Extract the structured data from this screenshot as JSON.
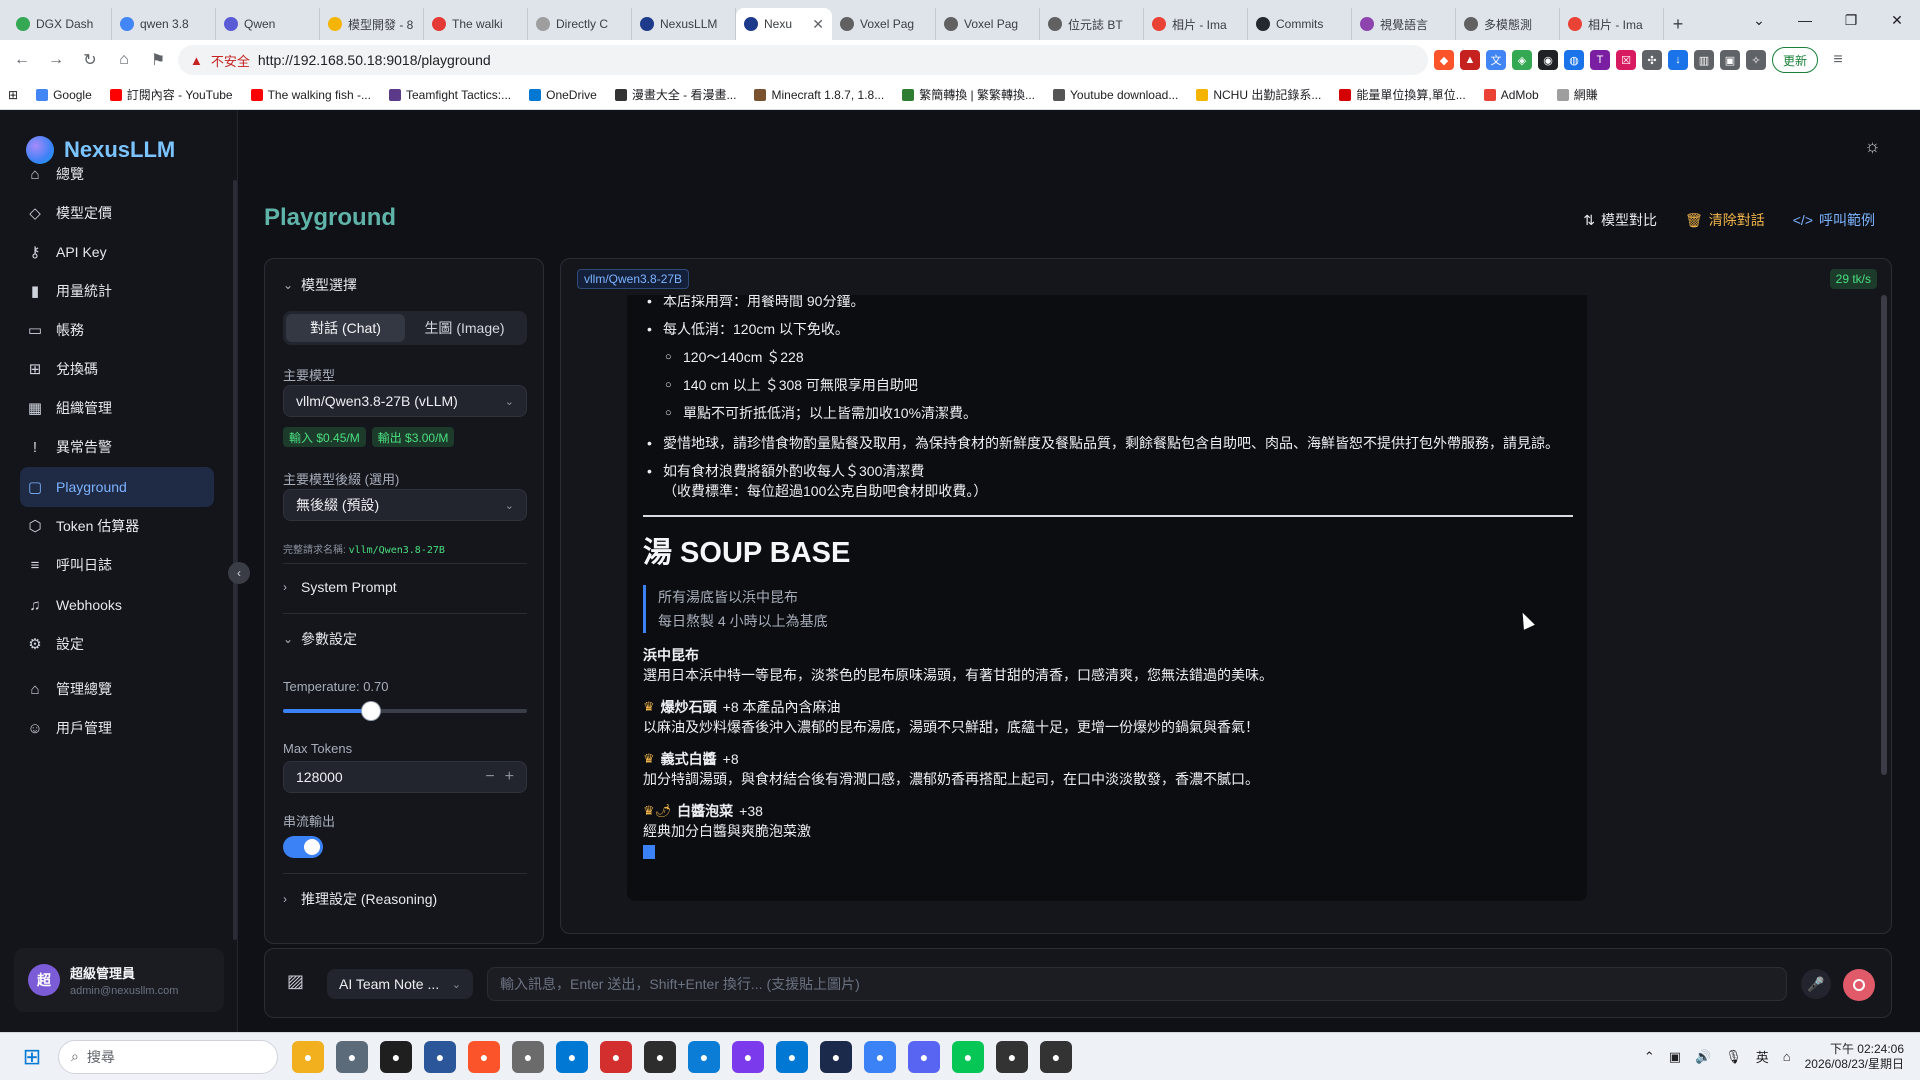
{
  "browser": {
    "tabs": [
      {
        "label": "DGX Dash",
        "color": "#34a853"
      },
      {
        "label": "qwen 3.8",
        "color": "#4285f4"
      },
      {
        "label": "Qwen",
        "color": "#5b5bd6"
      },
      {
        "label": "模型開發 - 8",
        "color": "#f4b400"
      },
      {
        "label": "The walki",
        "color": "#e53935"
      },
      {
        "label": "Directly C",
        "color": "#9e9e9e"
      },
      {
        "label": "NexusLLM",
        "color": "#1e3a8a"
      },
      {
        "label": "Nexu",
        "color": "#1e3a8a",
        "active": true
      },
      {
        "label": "Voxel Pag",
        "color": "#616161"
      },
      {
        "label": "Voxel Pag",
        "color": "#616161"
      },
      {
        "label": "位元誌 BT",
        "color": "#616161"
      },
      {
        "label": "相片 - Ima",
        "color": "#ea4335"
      },
      {
        "label": "Commits",
        "color": "#24292f"
      },
      {
        "label": "視覺語言",
        "color": "#8e44ad"
      },
      {
        "label": "多模態測",
        "color": "#616161"
      },
      {
        "label": "相片 - Ima",
        "color": "#ea4335"
      }
    ],
    "new_tab": "+",
    "url": "http://192.168.50.18:9018/playground",
    "insecure_label": "不安全",
    "update_label": "更新",
    "bookmarks": [
      {
        "label": "Google",
        "color": "#4285f4"
      },
      {
        "label": "訂閱內容 - YouTube",
        "color": "#ff0000"
      },
      {
        "label": "The walking fish -...",
        "color": "#ff0000"
      },
      {
        "label": "Teamfight Tactics:...",
        "color": "#5b3a8a"
      },
      {
        "label": "OneDrive",
        "color": "#0078d4"
      },
      {
        "label": "漫畫大全 - 看漫畫...",
        "color": "#333333"
      },
      {
        "label": "Minecraft 1.8.7, 1.8...",
        "color": "#7a5230"
      },
      {
        "label": "繁簡轉換 | 繁繁轉換...",
        "color": "#2e7d32"
      },
      {
        "label": "Youtube download...",
        "color": "#555555"
      },
      {
        "label": "NCHU 出勤記錄系...",
        "color": "#f4b400"
      },
      {
        "label": "能量單位換算,單位...",
        "color": "#d50000"
      },
      {
        "label": "AdMob",
        "color": "#ea4335"
      },
      {
        "label": "網賺",
        "color": "#9e9e9e"
      }
    ]
  },
  "app": {
    "name": "NexusLLM",
    "page_title": "Playground",
    "nav": [
      {
        "label": "總覽",
        "icon": "home-icon",
        "glyph": "⌂"
      },
      {
        "label": "模型定價",
        "icon": "tag-icon",
        "glyph": "◇"
      },
      {
        "label": "API Key",
        "icon": "key-icon",
        "glyph": "⚷"
      },
      {
        "label": "用量統計",
        "icon": "bar-chart-icon",
        "glyph": "▮"
      },
      {
        "label": "帳務",
        "icon": "wallet-icon",
        "glyph": "▭"
      },
      {
        "label": "兌換碼",
        "icon": "gift-icon",
        "glyph": "⊞"
      },
      {
        "label": "組織管理",
        "icon": "building-icon",
        "glyph": "▦"
      },
      {
        "label": "異常告警",
        "icon": "alert-icon",
        "glyph": "!"
      },
      {
        "label": "Playground",
        "icon": "chat-icon",
        "glyph": "▢",
        "active": true
      },
      {
        "label": "Token 估算器",
        "icon": "cube-icon",
        "glyph": "⬡"
      },
      {
        "label": "呼叫日誌",
        "icon": "list-icon",
        "glyph": "≡"
      },
      {
        "label": "Webhooks",
        "icon": "bell-icon",
        "glyph": "♫"
      },
      {
        "label": "設定",
        "icon": "gear-icon",
        "glyph": "⚙"
      },
      {
        "label": "管理總覽",
        "icon": "home-icon",
        "glyph": "⌂"
      },
      {
        "label": "用戶管理",
        "icon": "users-icon",
        "glyph": "☺"
      }
    ],
    "user": {
      "initial": "超",
      "name": "超級管理員",
      "email": "admin@nexusllm.com"
    },
    "header_actions": {
      "compare": "模型對比",
      "clear": "清除對話",
      "example": "呼叫範例"
    }
  },
  "panel": {
    "model_section": "模型選擇",
    "mode_chat": "對話 (Chat)",
    "mode_image": "生圖 (Image)",
    "main_model_label": "主要模型",
    "main_model_value": "vllm/Qwen3.8-27B (vLLM)",
    "price_in": "輸入 $0.45/M",
    "price_out": "輸出 $3.00/M",
    "suffix_label": "主要模型後綴 (選用)",
    "suffix_value": "無後綴 (預設)",
    "fullname_label": "完整請求名稱:",
    "fullname_value": "vllm/Qwen3.8-27B",
    "system_prompt": "System Prompt",
    "params_section": "參數設定",
    "temperature_label": "Temperature: 0.70",
    "temperature_fraction": 0.36,
    "max_tokens_label": "Max Tokens",
    "max_tokens_value": "128000",
    "stream_label": "串流輸出",
    "reasoning_section": "推理設定 (Reasoning)"
  },
  "chat": {
    "model_tag": "vllm/Qwen3.8-27B",
    "speed": "29 tk/s",
    "cut_line": "本店採用齊：用餐時間 90分鐘。",
    "min_charge": "每人低消：120cm 以下免收。",
    "sub_items": [
      "120～140cm ＄228",
      "140 cm 以上 ＄308 可無限享用自助吧",
      "單點不可折抵低消；以上皆需加收10%清潔費。"
    ],
    "eco_note": "愛惜地球，請珍惜食物酌量點餐及取用，為保持食材的新鮮度及餐點品質，剩餘餐點包含自助吧、肉品、海鮮皆恕不提供打包外帶服務，請見諒。",
    "waste_fee": "如有食材浪費將額外酌收每人＄300清潔費",
    "waste_rule": "（收費標準：每位超過100公克自助吧食材即收費。）",
    "heading": "湯 SOUP BASE",
    "quote_1": "所有湯底皆以浜中昆布",
    "quote_2": "每日熬製 4 小時以上為基底",
    "base_title": "浜中昆布",
    "base_desc": "選用日本浜中特一等昆布，淡茶色的昆布原味湯頭，有著甘甜的清香，口感清爽，您無法錯過的美味。",
    "items": [
      {
        "title": "爆炒石頭",
        "price": "+8 本產品內含麻油",
        "desc": "以麻油及炒料爆香後沖入濃郁的昆布湯底，湯頭不只鮮甜，底蘊十足，更增一份爆炒的鍋氣與香氣！",
        "icons": "♛"
      },
      {
        "title": "義式白醬",
        "price": "+8",
        "desc": "加分特調湯頭，與食材結合後有滑潤口感，濃郁奶香再搭配上起司，在口中淡淡散發，香濃不膩口。",
        "icons": "♛"
      },
      {
        "title": "白醬泡菜",
        "price": "+38",
        "desc": "經典加分白醬與爽脆泡菜激",
        "icons": "♛🌶"
      }
    ]
  },
  "input": {
    "prompt_select": "AI Team Note ...",
    "placeholder": "輸入訊息，Enter 送出，Shift+Enter 換行... (支援貼上圖片)"
  },
  "taskbar": {
    "search": "搜尋",
    "time": "下午 02:24:06",
    "date": "2026/08/23/星期日",
    "ime": "英",
    "apps": [
      {
        "name": "file-explorer-icon",
        "color": "#f2b01e"
      },
      {
        "name": "calculator-icon",
        "color": "#5c6b7a"
      },
      {
        "name": "terminal-icon",
        "color": "#1f1f1f"
      },
      {
        "name": "word-icon",
        "color": "#2b579a"
      },
      {
        "name": "brave-icon",
        "color": "#fb542b"
      },
      {
        "name": "chatgpt-icon",
        "color": "#6b6b6b"
      },
      {
        "name": "photos-icon",
        "color": "#0078d4"
      },
      {
        "name": "app-red-icon",
        "color": "#d32f2f"
      },
      {
        "name": "cmd-icon",
        "color": "#2d2d2d"
      },
      {
        "name": "edge-icon",
        "color": "#0c7dd6"
      },
      {
        "name": "obs-icon",
        "color": "#7c3aed"
      },
      {
        "name": "vscode-icon",
        "color": "#0078d4"
      },
      {
        "name": "ai-icon",
        "color": "#1b2a4a"
      },
      {
        "name": "a-icon",
        "color": "#3b82f6"
      },
      {
        "name": "discord-icon",
        "color": "#5865f2"
      },
      {
        "name": "line-icon",
        "color": "#06c755"
      },
      {
        "name": "headset-icon",
        "color": "#333333"
      },
      {
        "name": "camera-icon",
        "color": "#333333"
      }
    ]
  }
}
